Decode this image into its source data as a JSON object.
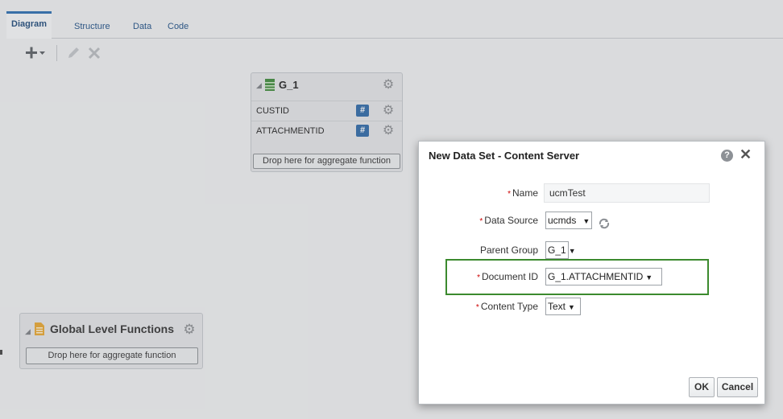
{
  "tabs": [
    {
      "label": "Diagram",
      "active": true
    },
    {
      "label": "Structure",
      "active": false
    },
    {
      "label": "Data",
      "active": false
    },
    {
      "label": "Code",
      "active": false
    }
  ],
  "toolbar": {
    "add": "add-icon",
    "edit": "edit-icon",
    "delete": "delete-icon"
  },
  "group": {
    "name": "G_1",
    "fields": [
      "CUSTID",
      "ATTACHMENTID"
    ],
    "drop_text": "Drop here for aggregate function"
  },
  "global": {
    "title": "Global Level Functions",
    "drop_text": "Drop here for aggregate function"
  },
  "dialog": {
    "title": "New Data Set - Content Server",
    "required_marker": "*",
    "name_label": "Name",
    "name_value": "ucmTest",
    "data_source_label": "Data Source",
    "data_source_value": "ucmds",
    "parent_group_label": "Parent Group",
    "parent_group_value": "G_1",
    "document_id_label": "Document ID",
    "document_id_value": "G_1.ATTACHMENTID",
    "content_type_label": "Content Type",
    "content_type_value": "Text",
    "ok_label": "OK",
    "cancel_label": "Cancel",
    "help_glyph": "?",
    "close_glyph": "✕"
  },
  "colors": {
    "accent": "#2a6db0",
    "highlight": "#3c8a2e",
    "hash_badge": "#2e6aa8"
  }
}
